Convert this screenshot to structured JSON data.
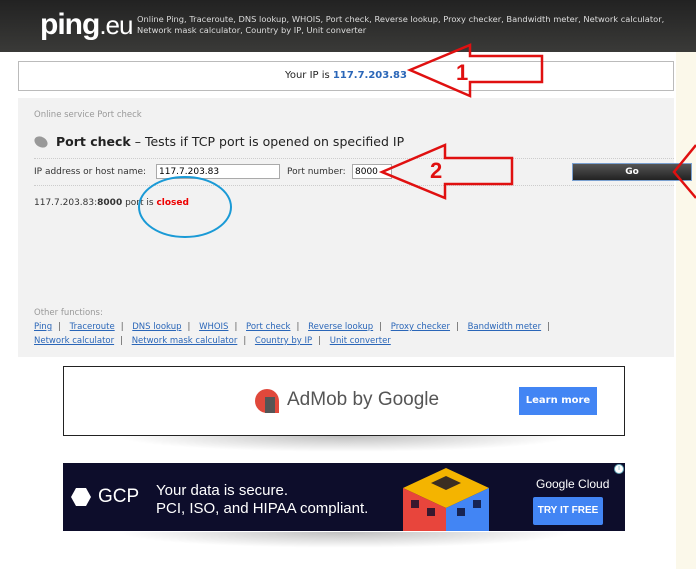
{
  "header": {
    "logo_main": "ping",
    "logo_tld": ".eu",
    "tagline": "Online Ping, Traceroute, DNS lookup, WHOIS, Port check, Reverse lookup, Proxy checker, Bandwidth meter, Network calculator, Network mask calculator, Country by IP, Unit converter"
  },
  "ip_banner": {
    "label": "Your IP is ",
    "ip": "117.7.203.83"
  },
  "panel": {
    "breadcrumb": "Online service Port check",
    "title": "Port check",
    "subtitle": " – Tests if TCP port is opened on specified IP",
    "ip_label": "IP address or host name:",
    "ip_value": "117.7.203.83",
    "port_label": "Port number:",
    "port_value": "8000",
    "go_label": "Go",
    "result": {
      "host": "117.7.203.83:",
      "port": "8000",
      "middle": " port is ",
      "status": "closed"
    },
    "other_label": "Other functions:",
    "links": [
      "Ping",
      "Traceroute",
      "DNS lookup",
      "WHOIS",
      "Port check",
      "Reverse lookup",
      "Proxy checker",
      "Bandwidth meter",
      "Network calculator",
      "Network mask calculator",
      "Country by IP",
      "Unit converter"
    ]
  },
  "ads": {
    "admob": {
      "brand": "AdMob by Google",
      "cta": "Learn more"
    },
    "gcp": {
      "brand": "GCP",
      "line1": "Your data is secure.",
      "line2": "PCI, ISO, and HIPAA compliant.",
      "company": "Google Cloud",
      "cta": "TRY IT FREE",
      "info": "i"
    }
  },
  "annotations": {
    "arrow1": "1",
    "arrow2": "2",
    "arrow_color": "#e01010",
    "circle_color": "#1a9ad6"
  },
  "colors": {
    "link": "#2a66b8",
    "closed": "#ee0000",
    "cta": "#4285f4"
  }
}
